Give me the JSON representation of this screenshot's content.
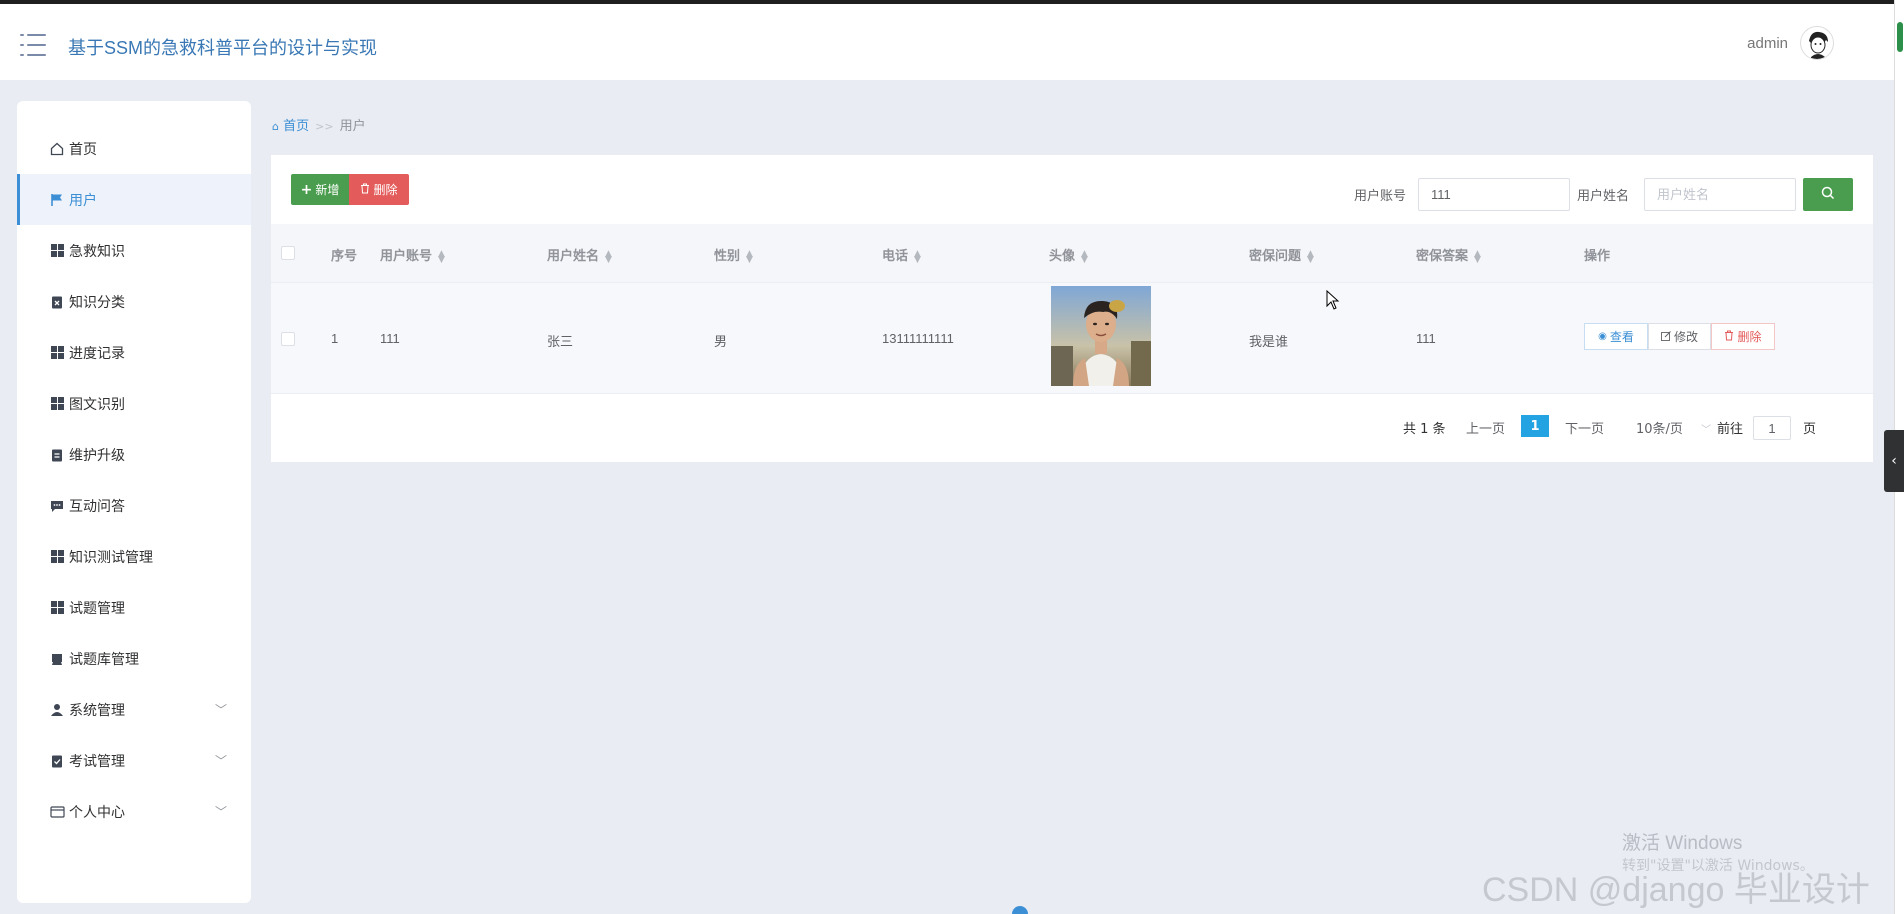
{
  "header": {
    "app_title": "基于SSM的急救科普平台的设计与实现",
    "username": "admin"
  },
  "sidebar": {
    "items": [
      {
        "label": "首页",
        "icon": "home-icon"
      },
      {
        "label": "用户",
        "icon": "flag-icon",
        "active": true
      },
      {
        "label": "急救知识",
        "icon": "grid-icon"
      },
      {
        "label": "知识分类",
        "icon": "clipboard-x-icon"
      },
      {
        "label": "进度记录",
        "icon": "grid-icon"
      },
      {
        "label": "图文识别",
        "icon": "grid-icon"
      },
      {
        "label": "维护升级",
        "icon": "clipboard-icon"
      },
      {
        "label": "互动问答",
        "icon": "chat-icon"
      },
      {
        "label": "知识测试管理",
        "icon": "grid-icon"
      },
      {
        "label": "试题管理",
        "icon": "grid-icon"
      },
      {
        "label": "试题库管理",
        "icon": "tray-icon"
      },
      {
        "label": "系统管理",
        "icon": "user-icon",
        "expandable": true
      },
      {
        "label": "考试管理",
        "icon": "clipboard-check-icon",
        "expandable": true
      },
      {
        "label": "个人中心",
        "icon": "wallet-icon",
        "expandable": true
      }
    ]
  },
  "breadcrumb": {
    "home": "首页",
    "separator": ">>",
    "current": "用户"
  },
  "toolbar": {
    "add_label": "新增",
    "delete_label": "删除",
    "account_label": "用户账号",
    "account_value": "111",
    "name_label": "用户姓名",
    "name_placeholder": "用户姓名"
  },
  "table": {
    "columns": [
      "序号",
      "用户账号",
      "用户姓名",
      "性别",
      "电话",
      "头像",
      "密保问题",
      "密保答案",
      "操作"
    ],
    "rows": [
      {
        "index": "1",
        "account": "111",
        "name": "张三",
        "gender": "男",
        "phone": "13111111111",
        "question": "我是谁",
        "answer": "111"
      }
    ],
    "actions": {
      "view": "查看",
      "edit": "修改",
      "delete": "删除"
    }
  },
  "pagination": {
    "total": "共 1 条",
    "prev": "上一页",
    "current_page": "1",
    "next": "下一页",
    "page_size": "10条/页",
    "goto_label": "前往",
    "goto_value": "1",
    "page_suffix": "页"
  },
  "overlay": {
    "activate_title": "激活 Windows",
    "activate_sub": "转到\"设置\"以激活 Windows。",
    "watermark": "CSDN @django 毕业设计"
  },
  "colors": {
    "primary": "#3c8fd4",
    "success": "#4a9d4e",
    "danger": "#e35b5a",
    "page_active": "#24a3e3"
  }
}
